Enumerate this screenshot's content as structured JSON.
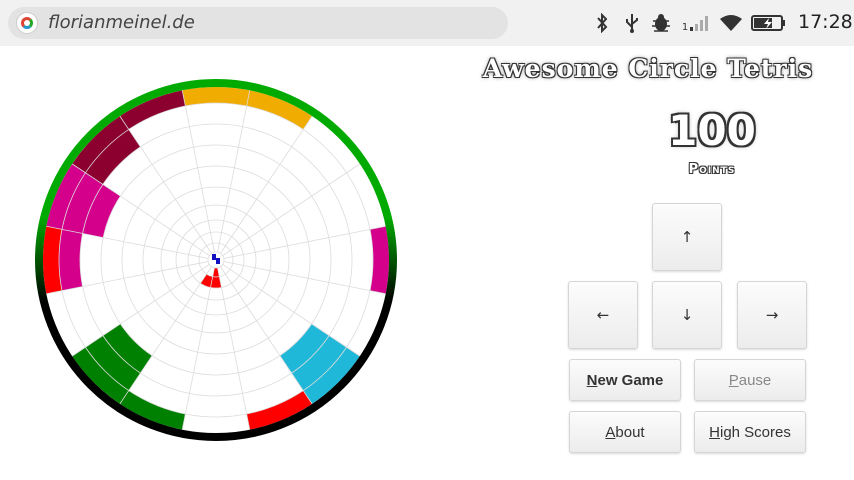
{
  "browser": {
    "url": "florianmeinel.de"
  },
  "status": {
    "time": "17:28",
    "icons": [
      "bluetooth-icon",
      "usb-icon",
      "bug-icon",
      "signal-icon",
      "wifi-icon",
      "battery-icon"
    ],
    "signal_sim_label": "1"
  },
  "game": {
    "title": "Awesome Circle Tetris",
    "score": "100",
    "score_label": "Points"
  },
  "controls": {
    "up": "↑",
    "left": "←",
    "down": "↓",
    "right": "→"
  },
  "buttons": {
    "new_game": {
      "accel": "N",
      "rest": "ew Game"
    },
    "pause": {
      "accel": "P",
      "rest": "ause"
    },
    "about": {
      "accel": "A",
      "rest": "bout"
    },
    "high_scores": {
      "accel": "H",
      "rest": "igh Scores"
    }
  },
  "colors": {
    "gold": "#f0ac00",
    "maroon": "#8c0030",
    "magenta": "#d4008c",
    "red": "#ff0000",
    "green": "#008000",
    "cyan": "#20b8d8",
    "ring_green": "#00aa00",
    "ring_black": "#000000",
    "piece_blue": "#1010c0"
  }
}
